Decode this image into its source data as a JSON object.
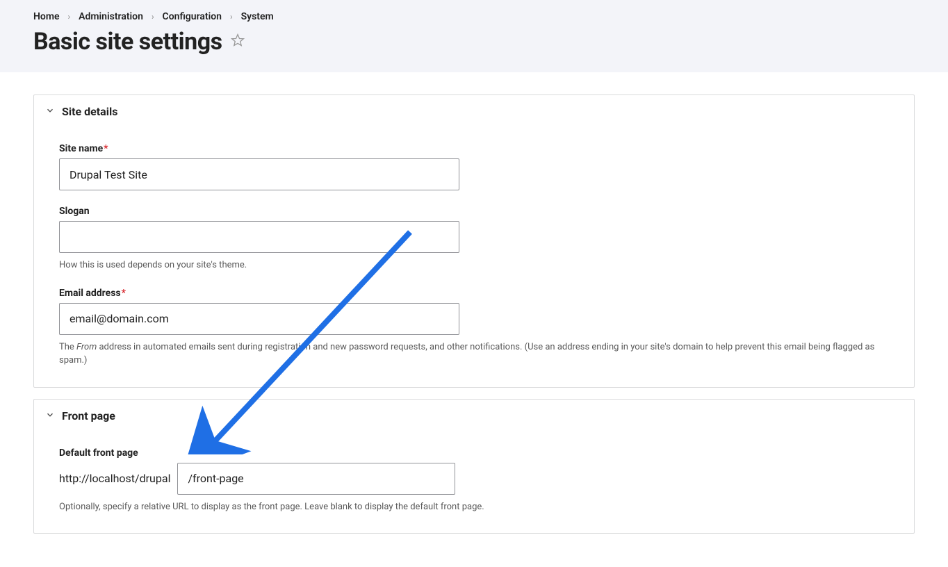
{
  "breadcrumb": {
    "items": [
      "Home",
      "Administration",
      "Configuration",
      "System"
    ]
  },
  "page_title": "Basic site settings",
  "panels": {
    "site_details": {
      "heading": "Site details",
      "site_name": {
        "label": "Site name",
        "value": "Drupal Test Site"
      },
      "slogan": {
        "label": "Slogan",
        "value": "",
        "description": "How this is used depends on your site's theme."
      },
      "email": {
        "label": "Email address",
        "value": "email@domain.com",
        "description_pre": "The ",
        "description_em": "From",
        "description_post": " address in automated emails sent during registration and new password requests, and other notifications. (Use an address ending in your site's domain to help prevent this email being flagged as spam.)"
      }
    },
    "front_page": {
      "heading": "Front page",
      "default_front_page": {
        "label": "Default front page",
        "prefix": "http://localhost/drupal",
        "value": "/front-page",
        "description": "Optionally, specify a relative URL to display as the front page. Leave blank to display the default front page."
      }
    }
  }
}
